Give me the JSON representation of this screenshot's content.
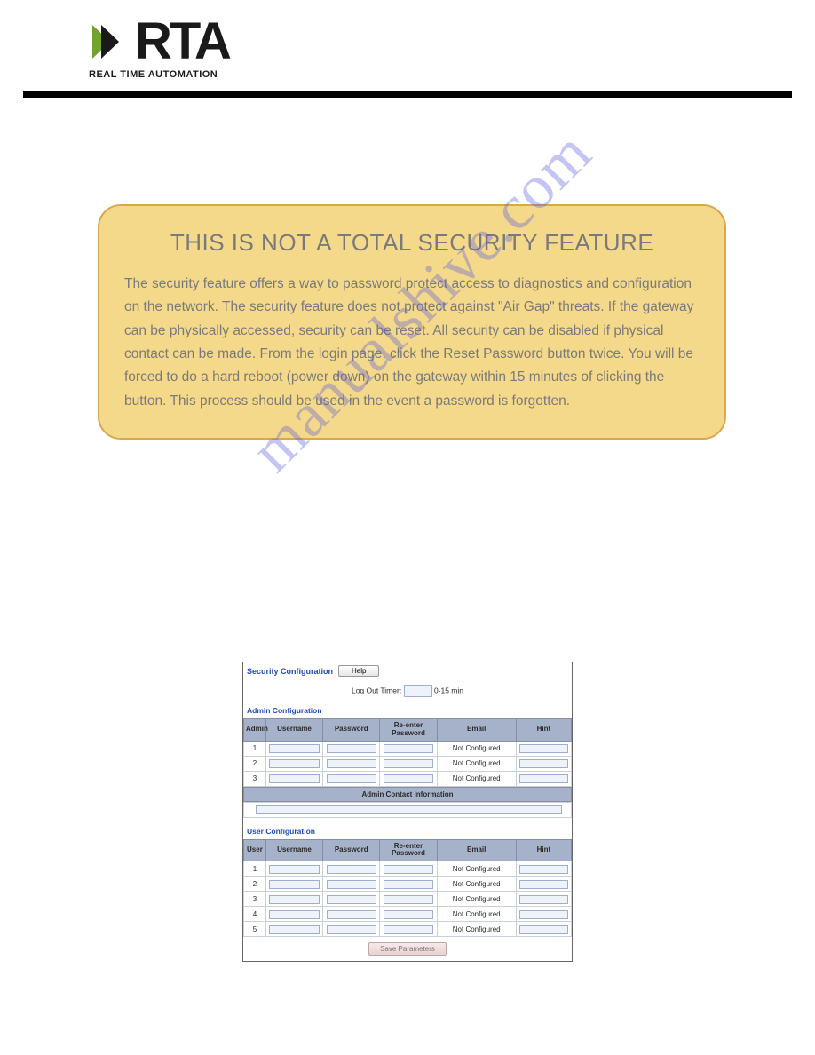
{
  "brand": {
    "name": "RTA",
    "subtitle": "REAL TIME AUTOMATION"
  },
  "watermark": "manualshive.com",
  "callout": {
    "title": "THIS IS NOT A TOTAL SECURITY FEATURE",
    "body": "The security feature offers a way to password protect access to diagnostics and configuration on the network. The security feature does not protect against \"Air Gap\" threats. If the gateway can be physically accessed, security can be reset. All security can be disabled if physical contact can be made. From the login page, click the Reset Password button twice. You will be forced to do a hard reboot (power down) on the gateway within 15 minutes of clicking the button. This process should be used in the event a password is forgotten."
  },
  "panel": {
    "title": "Security Configuration",
    "help_label": "Help",
    "logout_label": "Log Out Timer:",
    "logout_suffix": "0-15 min",
    "admin_section": "Admin Configuration",
    "user_section": "User Configuration",
    "admin_contact_header": "Admin Contact Information",
    "save_label": "Save Parameters",
    "headers": {
      "idx_admin": "Admin",
      "idx_user": "User",
      "username": "Username",
      "password": "Password",
      "repassword": "Re-enter Password",
      "email": "Email",
      "hint": "Hint"
    },
    "admin_rows": [
      {
        "idx": "1",
        "email": "Not Configured"
      },
      {
        "idx": "2",
        "email": "Not Configured"
      },
      {
        "idx": "3",
        "email": "Not Configured"
      }
    ],
    "user_rows": [
      {
        "idx": "1",
        "email": "Not Configured"
      },
      {
        "idx": "2",
        "email": "Not Configured"
      },
      {
        "idx": "3",
        "email": "Not Configured"
      },
      {
        "idx": "4",
        "email": "Not Configured"
      },
      {
        "idx": "5",
        "email": "Not Configured"
      }
    ]
  }
}
